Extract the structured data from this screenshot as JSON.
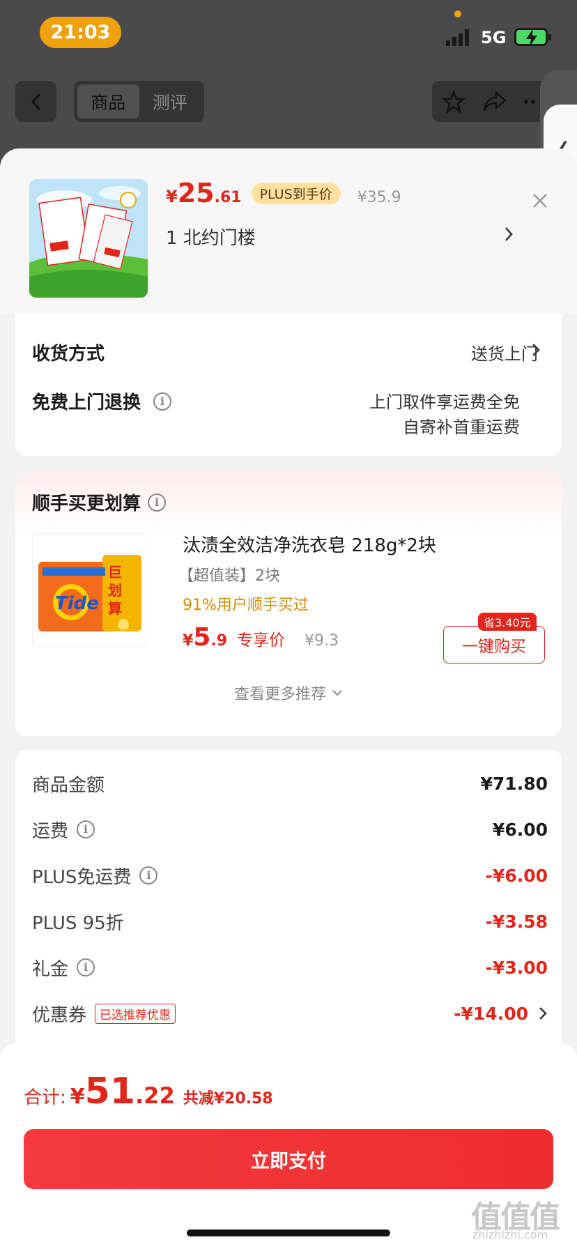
{
  "status_bar": {
    "time": "21:03",
    "network": "5G"
  },
  "nav": {
    "tabs": [
      "商品",
      "测评"
    ]
  },
  "sheet": {
    "price": {
      "currency": "¥",
      "integer": "25",
      "decimal": ".61",
      "badge": "PLUS到手价",
      "original": "¥35.9"
    },
    "address": "1  北约门楼"
  },
  "delivery": {
    "method_label": "收货方式",
    "method_value": "送货上门",
    "return_label": "免费上门退换",
    "return_line1": "上门取件享运费全免",
    "return_line2": "自寄补首重运费"
  },
  "add_on": {
    "title": "顺手买更划算",
    "product_name": "汰渍全效洁净洗衣皂 218g*2块",
    "spec": "【超值装】2块",
    "social_proof": "91%用户顺手买过",
    "price_currency": "¥",
    "price_int": "5",
    "price_dec": ".9",
    "price_tag": "专享价",
    "original": "¥9.3",
    "save_tag": "省3.40元",
    "buy_label": "一键购买",
    "more_label": "查看更多推荐"
  },
  "summary": {
    "rows": [
      {
        "label": "商品金额",
        "value": "¥71.80",
        "red": false
      },
      {
        "label": "运费",
        "value": "¥6.00",
        "red": false
      },
      {
        "label": "PLUS免运费",
        "value": "-¥6.00",
        "red": true
      },
      {
        "label": "PLUS 95折",
        "value": "-¥3.58",
        "red": true
      },
      {
        "label": "礼金",
        "value": "-¥3.00",
        "red": true
      },
      {
        "label": "优惠券",
        "tag": "已选推荐优惠",
        "value": "-¥14.00",
        "red": true
      }
    ]
  },
  "footer": {
    "total_label": "合计:",
    "currency": "¥",
    "total_int": "51",
    "total_dec": ".22",
    "discount_label": "共减¥20.58",
    "pay_label": "立即支付"
  },
  "watermark": {
    "main": "值值值",
    "sub": "zhizhizhi.com"
  },
  "colors": {
    "accent": "#e1251b",
    "status_pill": "#f0a10e",
    "plus_badge": "#ffe0a0"
  }
}
